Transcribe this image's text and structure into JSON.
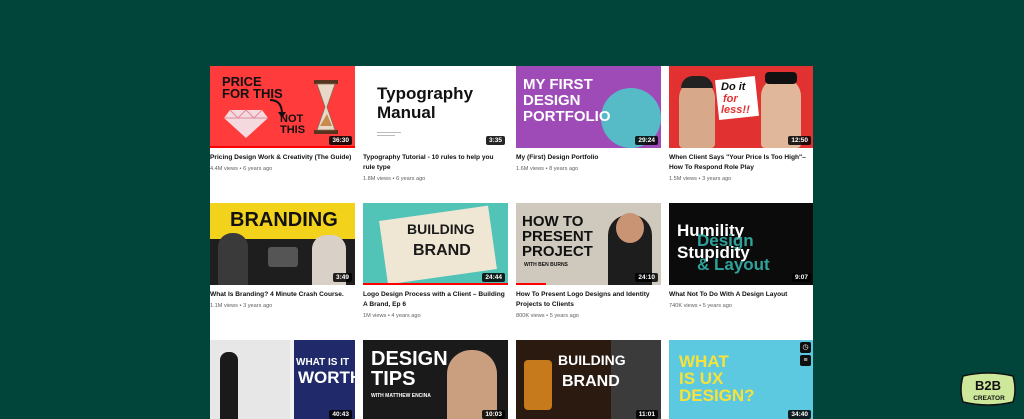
{
  "videos": [
    {
      "title": "Pricing Design Work & Creativity (The Guide)",
      "views": "4.4M views",
      "age": "6 years ago",
      "duration": "36:30",
      "thumb_text": [
        "PRICE",
        "FOR THIS",
        "NOT",
        "THIS"
      ]
    },
    {
      "title": "Typography Tutorial - 10 rules to help you rule type",
      "views": "1.8M views",
      "age": "6 years ago",
      "duration": "3:35",
      "thumb_text": [
        "Typography",
        "Manual"
      ]
    },
    {
      "title": "My (First) Design Portfolio",
      "views": "1.6M views",
      "age": "8 years ago",
      "duration": "29:24",
      "thumb_text": [
        "MY FIRST",
        "DESIGN",
        "PORTFOLIO"
      ]
    },
    {
      "title": "When Client Says \"Your Price Is Too High\"– How To Respond Role Play",
      "views": "1.5M views",
      "age": "3 years ago",
      "duration": "12:50",
      "thumb_text": [
        "Do it",
        "for",
        "less!!"
      ]
    },
    {
      "title": "What Is Branding? 4 Minute Crash Course.",
      "views": "1.1M views",
      "age": "3 years ago",
      "duration": "3:49",
      "thumb_text": [
        "BRANDING"
      ]
    },
    {
      "title": "Logo Design Process with a Client – Building A Brand, Ep 6",
      "views": "1M views",
      "age": "4 years ago",
      "duration": "24:44",
      "thumb_text": [
        "BUILDING",
        "BRAND"
      ]
    },
    {
      "title": "How To Present Logo Designs and Identity Projects to Clients",
      "views": "800K views",
      "age": "5 years ago",
      "duration": "24:10",
      "thumb_text": [
        "HOW TO",
        "PRESENT",
        "PROJECT",
        "WITH BEN BURNS"
      ]
    },
    {
      "title": "What Not To Do With A Design Layout",
      "views": "740K views",
      "age": "5 years ago",
      "duration": "9:07",
      "thumb_text": [
        "Humility",
        "Design",
        "Stupidity",
        "& Layout"
      ]
    },
    {
      "title": "",
      "views": "",
      "age": "",
      "duration": "40:43",
      "thumb_text": [
        "WHAT IS IT",
        "WORTH?"
      ]
    },
    {
      "title": "",
      "views": "",
      "age": "",
      "duration": "10:03",
      "thumb_text": [
        "DESIGN",
        "TIPS",
        "WITH MATTHEW ENCINA"
      ]
    },
    {
      "title": "",
      "views": "",
      "age": "",
      "duration": "11:01",
      "thumb_text": [
        "BUILDING",
        "BRAND"
      ]
    },
    {
      "title": "",
      "views": "",
      "age": "",
      "duration": "34:40",
      "thumb_text": [
        "WHAT",
        "IS UX",
        "DESIGN?"
      ]
    }
  ],
  "logo": {
    "line1": "B2B",
    "line2": "CREATOR"
  },
  "colors": {
    "background": "#01443a",
    "panel": "#ffffff",
    "accent_red": "#ff0000"
  },
  "icons": [
    "clock-icon",
    "playlist-add-icon"
  ]
}
